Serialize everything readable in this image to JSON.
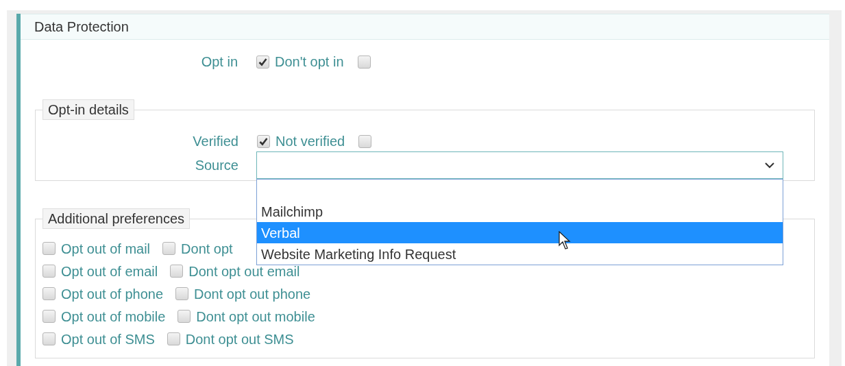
{
  "panel": {
    "title": "Data Protection"
  },
  "opt_in_row": {
    "label": "Opt in",
    "options": [
      {
        "label": "Don't opt in",
        "checked": true
      },
      {
        "checked": false
      }
    ]
  },
  "opt_in_details": {
    "legend": "Opt-in details",
    "verified_label": "Verified",
    "verified_options": [
      {
        "label": "Not verified",
        "checked": true
      },
      {
        "checked": false
      }
    ],
    "source_label": "Source",
    "source_dropdown": {
      "expanded": true,
      "options": [
        {
          "selected": false
        },
        {
          "label": "Mailchimp",
          "selected": false
        },
        {
          "label": "Verbal",
          "selected": true
        },
        {
          "label": "Website Marketing Info Request",
          "selected": false
        }
      ]
    }
  },
  "additional_preferences": {
    "legend": "Additional preferences",
    "rows": [
      {
        "opt_out": {
          "label": "Opt out of mail",
          "checked": false
        },
        "dont_opt_out": {
          "label": "Dont opt",
          "checked": false
        }
      },
      {
        "opt_out": {
          "label": "Opt out of email",
          "checked": false
        },
        "dont_opt_out": {
          "label": "Dont opt out email",
          "checked": false
        }
      },
      {
        "opt_out": {
          "label": "Opt out of phone",
          "checked": false
        },
        "dont_opt_out": {
          "label": "Dont opt out phone",
          "checked": false
        }
      },
      {
        "opt_out": {
          "label": "Opt out of mobile",
          "checked": false
        },
        "dont_opt_out": {
          "label": "Dont opt out mobile",
          "checked": false
        }
      },
      {
        "opt_out": {
          "label": "Opt out of SMS",
          "checked": false
        },
        "dont_opt_out": {
          "label": "Dont opt out SMS",
          "checked": false
        }
      }
    ]
  }
}
